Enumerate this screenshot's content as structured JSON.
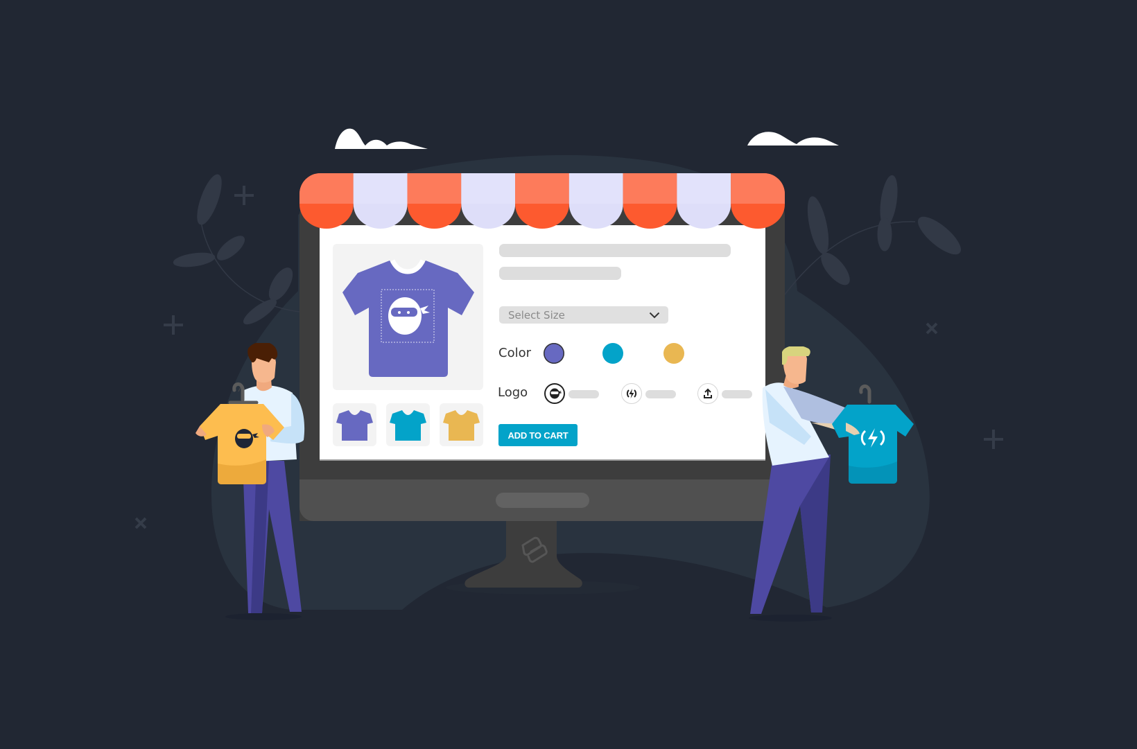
{
  "scene": {
    "description": "Online storefront illustration: a computer monitor with a striped shop awning displaying a t-shirt product customizer, flanked by two people holding t-shirts on hangers",
    "colors": {
      "background": "#212733",
      "blob": "#29333f",
      "awning_orange": "#fd5a2f",
      "awning_orange_light": "#fd7b5b",
      "awning_lavender": "#dedef9",
      "bezel": "#3d3d3d",
      "chin": "#505050"
    }
  },
  "product_page": {
    "main_image": {
      "product": "t-shirt",
      "color": "#6769c1",
      "print": "ninja-logo"
    },
    "thumbnails": [
      {
        "product": "t-shirt",
        "color": "#6769c1"
      },
      {
        "product": "t-shirt",
        "color": "#03a3c9"
      },
      {
        "product": "t-shirt",
        "color": "#e9b752"
      }
    ],
    "title_placeholder_lines": 2,
    "size_select": {
      "label": "Select Size",
      "icon": "chevron-down-icon"
    },
    "color": {
      "label": "Color",
      "options": [
        {
          "name": "purple",
          "hex": "#6769c1",
          "selected": true
        },
        {
          "name": "blue",
          "hex": "#03a3c9",
          "selected": false
        },
        {
          "name": "yellow",
          "hex": "#e9b752",
          "selected": false
        }
      ]
    },
    "logo": {
      "label": "Logo",
      "options": [
        {
          "icon": "ninja-icon",
          "selected": true
        },
        {
          "icon": "lightning-icon",
          "selected": false
        },
        {
          "icon": "upload-icon",
          "selected": false
        }
      ]
    },
    "add_to_cart": {
      "label": "ADD TO CART",
      "color": "#03a3c9"
    }
  },
  "people": [
    {
      "side": "left",
      "shirt_held": {
        "color": "#fdbd4f",
        "print": "ninja-logo"
      }
    },
    {
      "side": "right",
      "shirt_held": {
        "color": "#03a3c9",
        "print": "lightning-logo"
      }
    }
  ]
}
